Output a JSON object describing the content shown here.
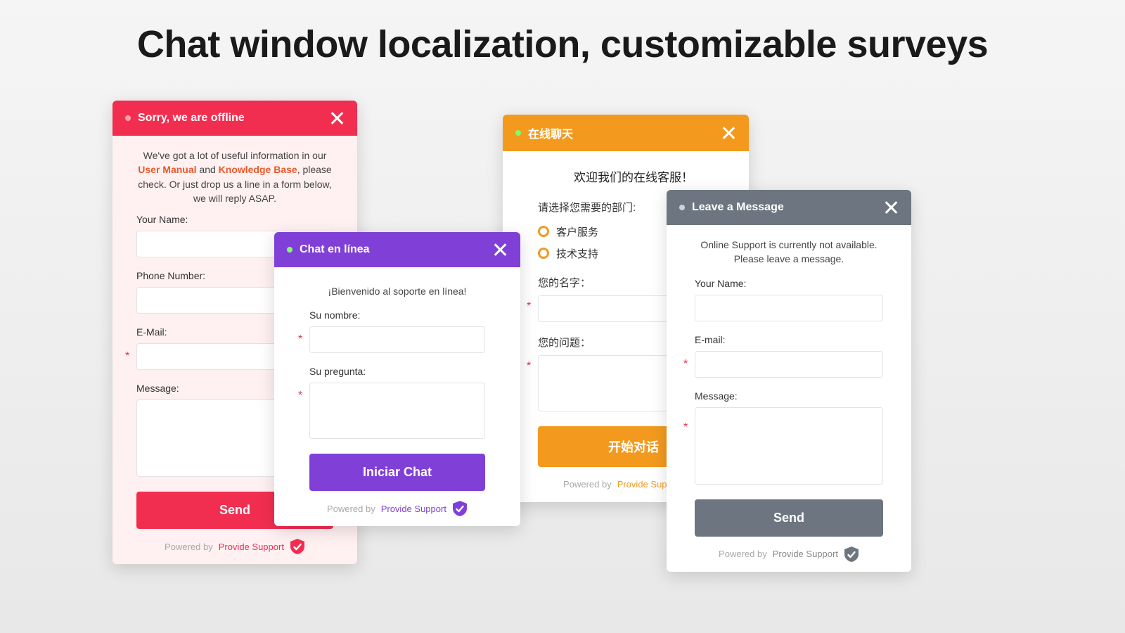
{
  "page": {
    "title": "Chat window localization, customizable surveys"
  },
  "powered": {
    "prefix": "Powered by",
    "brand": "Provide Support"
  },
  "red": {
    "header": "Sorry, we are offline",
    "intro_pre": "We've got a lot of useful information in our ",
    "link1": "User Manual",
    "intro_mid": " and ",
    "link2": "Knowledge Base",
    "intro_post": ", please check. Or just drop us a line in a form below, we will reply ASAP.",
    "f_name": "Your Name:",
    "f_phone": "Phone Number:",
    "f_email": "E-Mail:",
    "f_message": "Message:",
    "btn": "Send"
  },
  "purple": {
    "header": "Chat en línea",
    "intro": "¡Bienvenido al soporte en línea!",
    "f_name": "Su nombre:",
    "f_question": "Su pregunta:",
    "btn": "Iniciar Chat"
  },
  "orange": {
    "header": "在线聊天",
    "intro": "欢迎我们的在线客服！",
    "dept_label": "请选择您需要的部门:",
    "dept1": "客户服务",
    "dept2": "技术支持",
    "f_name": "您的名字：",
    "f_question": "您的问题：",
    "btn": "开始对话"
  },
  "grey": {
    "header": "Leave a Message",
    "intro": "Online Support is currently not available. Please leave a message.",
    "f_name": "Your Name:",
    "f_email": "E-mail:",
    "f_message": "Message:",
    "btn": "Send"
  }
}
